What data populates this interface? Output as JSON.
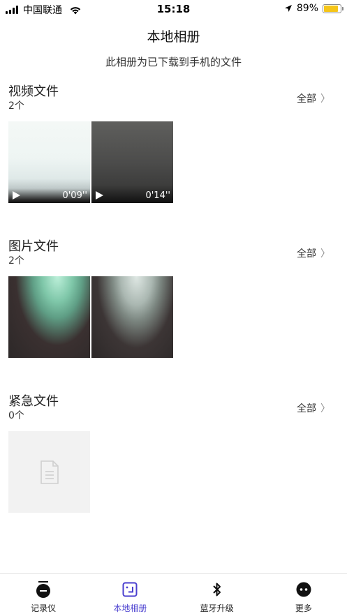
{
  "status_bar": {
    "carrier": "中国联通",
    "time": "15:18",
    "battery_pct": "89%",
    "battery_level": 0.89,
    "battery_color": "#f5c518"
  },
  "header": {
    "title": "本地相册",
    "subtitle": "此相册为已下载到手机的文件"
  },
  "sections": {
    "videos": {
      "title": "视频文件",
      "count": "2个",
      "all_label": "全部",
      "items": [
        {
          "duration": "0'09''"
        },
        {
          "duration": "0'14''"
        }
      ]
    },
    "images": {
      "title": "图片文件",
      "count": "2个",
      "all_label": "全部"
    },
    "emergency": {
      "title": "紧急文件",
      "count": "0个",
      "all_label": "全部"
    }
  },
  "tab_bar": {
    "active_color": "#4a3fcf",
    "tabs": [
      {
        "label": "记录仪",
        "icon": "recorder-icon"
      },
      {
        "label": "本地相册",
        "icon": "album-icon",
        "active": true
      },
      {
        "label": "蓝牙升级",
        "icon": "bluetooth-icon"
      },
      {
        "label": "更多",
        "icon": "more-icon"
      }
    ]
  }
}
